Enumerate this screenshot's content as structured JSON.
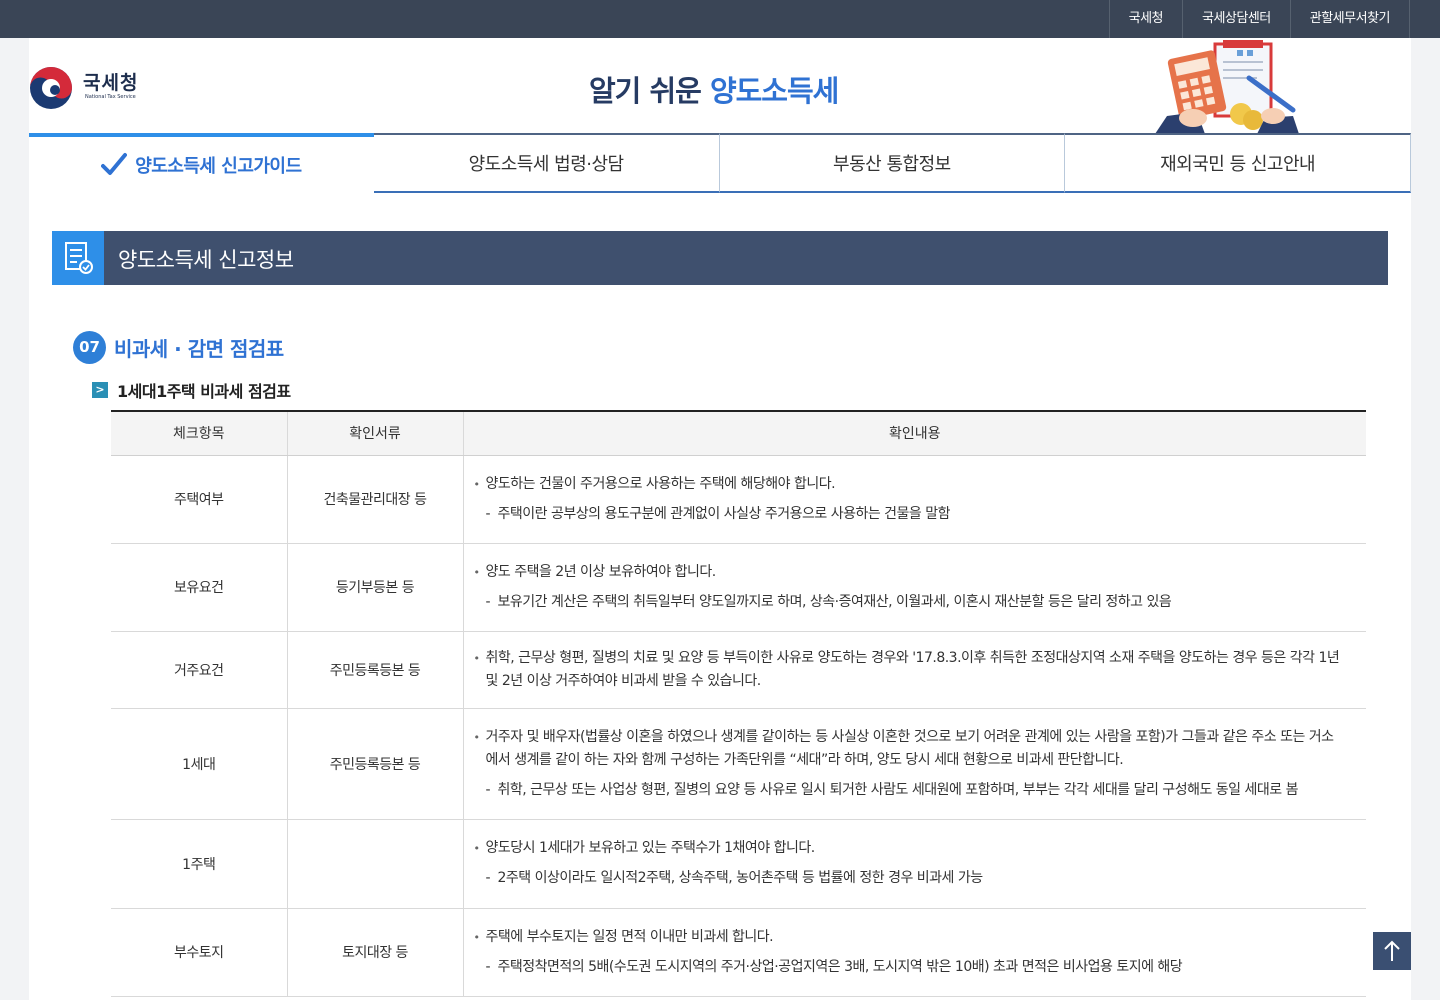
{
  "top_links": [
    "국세청",
    "국세상담센터",
    "관할세무서찾기"
  ],
  "logo": {
    "ko": "국세청",
    "en": "National Tax Service"
  },
  "site_title": {
    "prefix": "알기 쉬운",
    "highlight": "양도소득세"
  },
  "tabs": [
    {
      "label": "양도소득세 신고가이드",
      "active": true
    },
    {
      "label": "양도소득세 법령·상담",
      "active": false
    },
    {
      "label": "부동산 통합정보",
      "active": false
    },
    {
      "label": "재외국민 등 신고안내",
      "active": false
    }
  ],
  "section_title": "양도소득세 신고정보",
  "subsection": {
    "number": "07",
    "title": "비과세 · 감면 점검표"
  },
  "table_title": "1세대1주택 비과세 점검표",
  "table": {
    "headers": [
      "체크항목",
      "확인서류",
      "확인내용"
    ],
    "rows": [
      {
        "item": "주택여부",
        "doc": "건축물관리대장 등",
        "main": "양도하는 건물이 주거용으로 사용하는 주택에 해당해야 합니다.",
        "note": "주택이란 공부상의 용도구분에 관계없이 사실상 주거용으로 사용하는 건물을 말함"
      },
      {
        "item": "보유요건",
        "doc": "등기부등본 등",
        "main": "양도 주택을 2년 이상 보유하여야 합니다.",
        "note": "보유기간 계산은 주택의 취득일부터 양도일까지로 하며, 상속·증여재산, 이월과세, 이혼시 재산분할 등은 달리 정하고 있음"
      },
      {
        "item": "거주요건",
        "doc": "주민등록등본 등",
        "main": "취학, 근무상 형편, 질병의 치료 및 요양 등 부득이한 사유로 양도하는 경우와 '17.8.3.이후 취득한 조정대상지역 소재 주택을 양도하는 경우 등은 각각 1년 및 2년 이상 거주하여야 비과세 받을 수 있습니다.",
        "note": ""
      },
      {
        "item": "1세대",
        "doc": "주민등록등본 등",
        "main": "거주자 및 배우자(법률상 이혼을 하였으나 생계를 같이하는 등 사실상 이혼한 것으로 보기 어려운 관계에 있는 사람을 포함)가 그들과 같은 주소 또는 거소에서 생계를 같이 하는 자와 함께 구성하는 가족단위를 “세대”라 하며, 양도 당시 세대 현황으로 비과세 판단합니다.",
        "note": "취학, 근무상 또는 사업상 형편, 질병의 요양 등 사유로 일시 퇴거한 사람도 세대원에 포함하며, 부부는 각각 세대를 달리 구성해도 동일 세대로 봄"
      },
      {
        "item": "1주택",
        "doc": "",
        "main": "양도당시 1세대가 보유하고 있는 주택수가 1채여야 합니다.",
        "note": "2주택 이상이라도 일시적2주택, 상속주택, 농어촌주택 등 법률에 정한 경우 비과세 가능"
      },
      {
        "item": "부수토지",
        "doc": "토지대장 등",
        "main": "주택에 부수토지는 일정 면적 이내만 비과세 합니다.",
        "note": "주택정착면적의 5배(수도권 도시지역의 주거·상업·공업지역은 3배, 도시지역 밖은 10배) 초과 면적은 비사업용 토지에 해당"
      }
    ]
  },
  "colors": {
    "accent": "#2e8fe8",
    "title_blue": "#2f72d3",
    "navy": "#3f506e",
    "topbar": "#3a4556"
  }
}
